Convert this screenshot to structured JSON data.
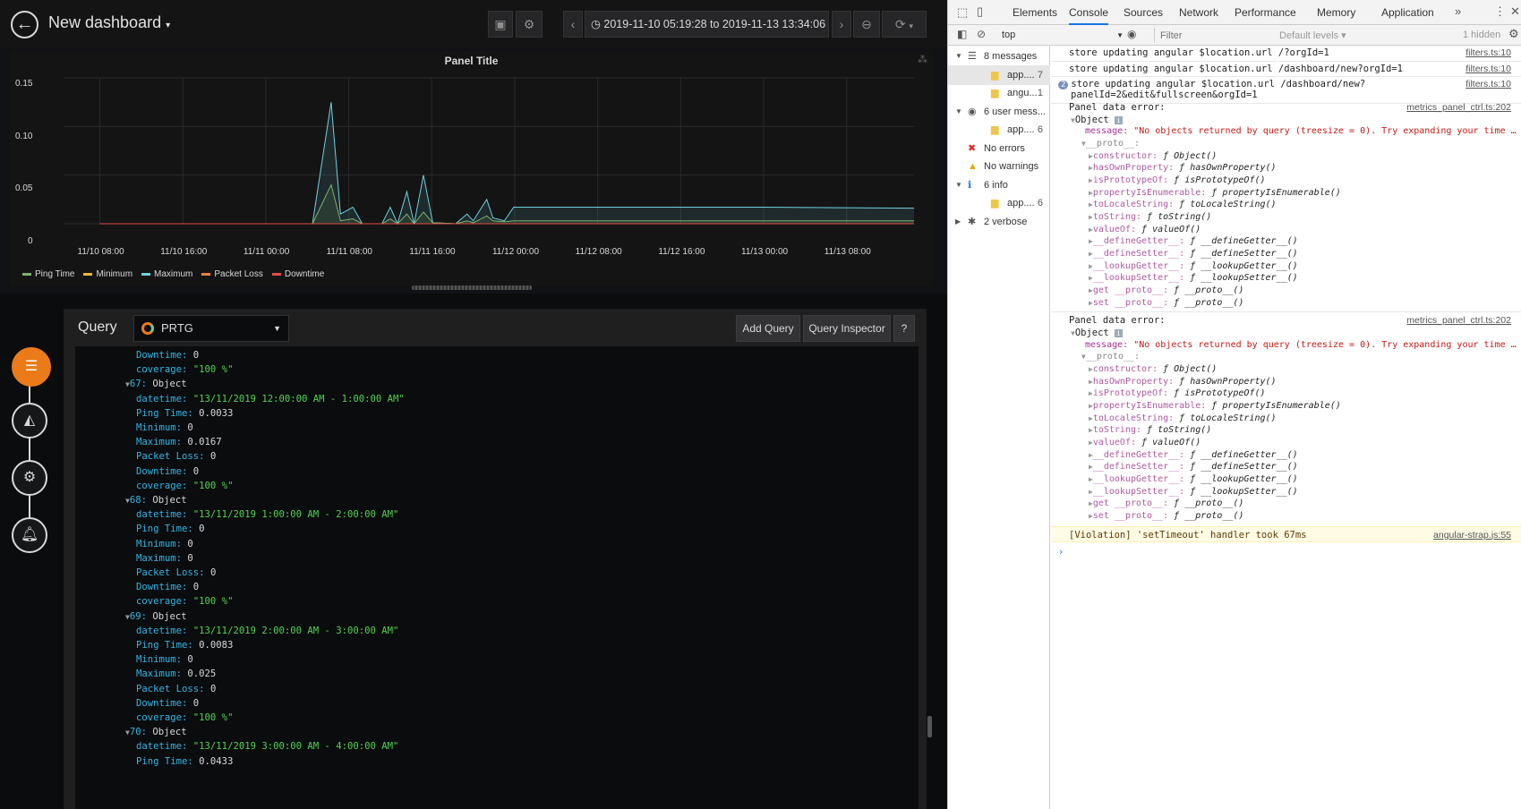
{
  "dashboard": {
    "title": "New dashboard",
    "time_range": "2019-11-10 05:19:28 to 2019-11-13 13:34:06"
  },
  "panel": {
    "title": "Panel Title",
    "legend": [
      {
        "name": "Ping Time",
        "color": "#7eb26d"
      },
      {
        "name": "Minimum",
        "color": "#eab839"
      },
      {
        "name": "Maximum",
        "color": "#6ed0e0"
      },
      {
        "name": "Packet Loss",
        "color": "#ef843c"
      },
      {
        "name": "Downtime",
        "color": "#e24d42"
      }
    ]
  },
  "chart_data": {
    "type": "area",
    "title": "Panel Title",
    "x_ticks": [
      "11/10 08:00",
      "11/10 16:00",
      "11/11 00:00",
      "11/11 08:00",
      "11/11 16:00",
      "11/12 00:00",
      "11/12 08:00",
      "11/12 16:00",
      "11/13 00:00",
      "11/13 08:00"
    ],
    "y_ticks": [
      "0.15",
      "0.10",
      "0.05",
      "0"
    ],
    "ylim": [
      0,
      0.15
    ],
    "grid": true,
    "legend_position": "bottom-left",
    "x_hours": [
      0,
      8,
      16,
      24,
      32,
      40,
      48,
      56,
      64,
      72
    ],
    "series": [
      {
        "name": "Maximum",
        "color": "#6ed0e0",
        "points": [
          [
            20.5,
            0
          ],
          [
            22.3,
            0.125
          ],
          [
            23.2,
            0.01
          ],
          [
            24.4,
            0.017
          ],
          [
            25.3,
            0
          ],
          [
            27.2,
            0
          ],
          [
            28.0,
            0.017
          ],
          [
            28.7,
            0
          ],
          [
            29.6,
            0.033
          ],
          [
            30.3,
            0
          ],
          [
            31.2,
            0.05
          ],
          [
            32.1,
            0.001
          ],
          [
            34.3,
            0
          ],
          [
            35.4,
            0.01
          ],
          [
            36.0,
            0.003
          ],
          [
            37.3,
            0.025
          ],
          [
            37.9,
            0.006
          ],
          [
            39.0,
            0.003
          ],
          [
            39.9,
            0.017
          ],
          [
            64,
            0.017
          ],
          [
            78.5,
            0.016
          ]
        ]
      },
      {
        "name": "Ping Time",
        "color": "#7eb26d",
        "points": [
          [
            20.5,
            0
          ],
          [
            22.3,
            0.04
          ],
          [
            23.2,
            0.003
          ],
          [
            24.4,
            0.005
          ],
          [
            25.3,
            0
          ],
          [
            27.2,
            0
          ],
          [
            28.0,
            0.005
          ],
          [
            28.7,
            0
          ],
          [
            29.6,
            0.01
          ],
          [
            30.3,
            0
          ],
          [
            31.2,
            0.012
          ],
          [
            32.1,
            0.001
          ],
          [
            34.3,
            0
          ],
          [
            35.4,
            0.003
          ],
          [
            36.0,
            0.001
          ],
          [
            37.3,
            0.008
          ],
          [
            37.9,
            0.003
          ],
          [
            39.0,
            0.002
          ],
          [
            39.9,
            0.003
          ],
          [
            64,
            0.003
          ],
          [
            78.5,
            0.003
          ]
        ]
      },
      {
        "name": "Minimum",
        "color": "#eab839",
        "points": [
          [
            0,
            0
          ],
          [
            78.5,
            0
          ]
        ]
      },
      {
        "name": "Packet Loss",
        "color": "#ef843c",
        "points": [
          [
            0,
            0
          ],
          [
            78.5,
            0
          ]
        ]
      },
      {
        "name": "Downtime",
        "color": "#e24d42",
        "points": [
          [
            0,
            0
          ],
          [
            78.5,
            0
          ]
        ]
      }
    ]
  },
  "query": {
    "title": "Query",
    "datasource": "PRTG",
    "add_query": "Add Query",
    "query_inspector": "Query Inspector",
    "help": "?"
  },
  "inspector": {
    "lines": [
      {
        "indent": 1,
        "key": "Downtime:",
        "val": "0",
        "type": "num"
      },
      {
        "indent": 1,
        "key": "coverage:",
        "val": "\"100 %\"",
        "type": "str"
      },
      {
        "indent": 0,
        "key": "67:",
        "val": "Object",
        "type": "obj"
      },
      {
        "indent": 1,
        "key": "datetime:",
        "val": "\"13/11/2019 12:00:00 AM - 1:00:00 AM\"",
        "type": "str"
      },
      {
        "indent": 1,
        "key": "Ping Time:",
        "val": "0.0033",
        "type": "num"
      },
      {
        "indent": 1,
        "key": "Minimum:",
        "val": "0",
        "type": "num"
      },
      {
        "indent": 1,
        "key": "Maximum:",
        "val": "0.0167",
        "type": "num"
      },
      {
        "indent": 1,
        "key": "Packet Loss:",
        "val": "0",
        "type": "num"
      },
      {
        "indent": 1,
        "key": "Downtime:",
        "val": "0",
        "type": "num"
      },
      {
        "indent": 1,
        "key": "coverage:",
        "val": "\"100 %\"",
        "type": "str"
      },
      {
        "indent": 0,
        "key": "68:",
        "val": "Object",
        "type": "obj"
      },
      {
        "indent": 1,
        "key": "datetime:",
        "val": "\"13/11/2019 1:00:00 AM - 2:00:00 AM\"",
        "type": "str"
      },
      {
        "indent": 1,
        "key": "Ping Time:",
        "val": "0",
        "type": "num"
      },
      {
        "indent": 1,
        "key": "Minimum:",
        "val": "0",
        "type": "num"
      },
      {
        "indent": 1,
        "key": "Maximum:",
        "val": "0",
        "type": "num"
      },
      {
        "indent": 1,
        "key": "Packet Loss:",
        "val": "0",
        "type": "num"
      },
      {
        "indent": 1,
        "key": "Downtime:",
        "val": "0",
        "type": "num"
      },
      {
        "indent": 1,
        "key": "coverage:",
        "val": "\"100 %\"",
        "type": "str"
      },
      {
        "indent": 0,
        "key": "69:",
        "val": "Object",
        "type": "obj"
      },
      {
        "indent": 1,
        "key": "datetime:",
        "val": "\"13/11/2019 2:00:00 AM - 3:00:00 AM\"",
        "type": "str"
      },
      {
        "indent": 1,
        "key": "Ping Time:",
        "val": "0.0083",
        "type": "num"
      },
      {
        "indent": 1,
        "key": "Minimum:",
        "val": "0",
        "type": "num"
      },
      {
        "indent": 1,
        "key": "Maximum:",
        "val": "0.025",
        "type": "num"
      },
      {
        "indent": 1,
        "key": "Packet Loss:",
        "val": "0",
        "type": "num"
      },
      {
        "indent": 1,
        "key": "Downtime:",
        "val": "0",
        "type": "num"
      },
      {
        "indent": 1,
        "key": "coverage:",
        "val": "\"100 %\"",
        "type": "str"
      },
      {
        "indent": 0,
        "key": "70:",
        "val": "Object",
        "type": "obj"
      },
      {
        "indent": 1,
        "key": "datetime:",
        "val": "\"13/11/2019 3:00:00 AM - 4:00:00 AM\"",
        "type": "str"
      },
      {
        "indent": 1,
        "key": "Ping Time:",
        "val": "0.0433",
        "type": "num"
      }
    ]
  },
  "devtools": {
    "tabs": [
      "Elements",
      "Console",
      "Sources",
      "Network",
      "Performance",
      "Memory",
      "Application"
    ],
    "active_tab": "Console",
    "context": "top",
    "filter_placeholder": "Filter",
    "levels": "Default levels ▾",
    "hidden": "1 hidden",
    "sidebar": [
      {
        "label": "8 messages",
        "count": "",
        "level": 0,
        "icon": "list-icon"
      },
      {
        "label": "app....",
        "count": "7",
        "level": 1,
        "icon": "file-icon",
        "selected": true
      },
      {
        "label": "angu...",
        "count": "1",
        "level": 1,
        "icon": "file-icon"
      },
      {
        "label": "6 user mess...",
        "count": "",
        "level": 0,
        "icon": "user-icon"
      },
      {
        "label": "app....",
        "count": "6",
        "level": 1,
        "icon": "file-icon"
      },
      {
        "label": "No errors",
        "count": "",
        "level": 0,
        "icon": "error-icon"
      },
      {
        "label": "No warnings",
        "count": "",
        "level": 0,
        "icon": "warning-icon"
      },
      {
        "label": "6 info",
        "count": "",
        "level": 0,
        "icon": "info-icon"
      },
      {
        "label": "app....",
        "count": "6",
        "level": 1,
        "icon": "file-icon"
      },
      {
        "label": "2 verbose",
        "count": "",
        "level": 0,
        "icon": "verbose-icon"
      }
    ],
    "messages": [
      {
        "text": "store updating angular $location.url /?orgId=1",
        "src": "filters.ts:10"
      },
      {
        "text": "store updating angular $location.url /dashboard/new?orgId=1",
        "src": "filters.ts:10"
      },
      {
        "text": "store updating angular $location.url /dashboard/new?",
        "text2": "panelId=2&edit&fullscreen&orgId=1",
        "src": "filters.ts:10",
        "count": "2"
      }
    ],
    "error_label": "Panel data error:",
    "error_src": "metrics_panel_ctrl.ts:202",
    "object_label": "Object",
    "message_key": "message:",
    "message_val": "\"No objects returned by query (treesize = 0). Try expanding your time …",
    "proto_label": "__proto__:",
    "proto_props": [
      {
        "k": "constructor:",
        "v": "ƒ Object()"
      },
      {
        "k": "hasOwnProperty:",
        "v": "ƒ hasOwnProperty()"
      },
      {
        "k": "isPrototypeOf:",
        "v": "ƒ isPrototypeOf()"
      },
      {
        "k": "propertyIsEnumerable:",
        "v": "ƒ propertyIsEnumerable()"
      },
      {
        "k": "toLocaleString:",
        "v": "ƒ toLocaleString()"
      },
      {
        "k": "toString:",
        "v": "ƒ toString()"
      },
      {
        "k": "valueOf:",
        "v": "ƒ valueOf()"
      },
      {
        "k": "__defineGetter__:",
        "v": "ƒ __defineGetter__()"
      },
      {
        "k": "__defineSetter__:",
        "v": "ƒ __defineSetter__()"
      },
      {
        "k": "__lookupGetter__:",
        "v": "ƒ __lookupGetter__()"
      },
      {
        "k": "__lookupSetter__:",
        "v": "ƒ __lookupSetter__()"
      },
      {
        "k": "get __proto__:",
        "v": "ƒ __proto__()"
      },
      {
        "k": "set __proto__:",
        "v": "ƒ __proto__()"
      }
    ],
    "violation": "[Violation] 'setTimeout' handler took 67ms",
    "violation_src": "angular-strap.js:55",
    "prompt": "›"
  }
}
